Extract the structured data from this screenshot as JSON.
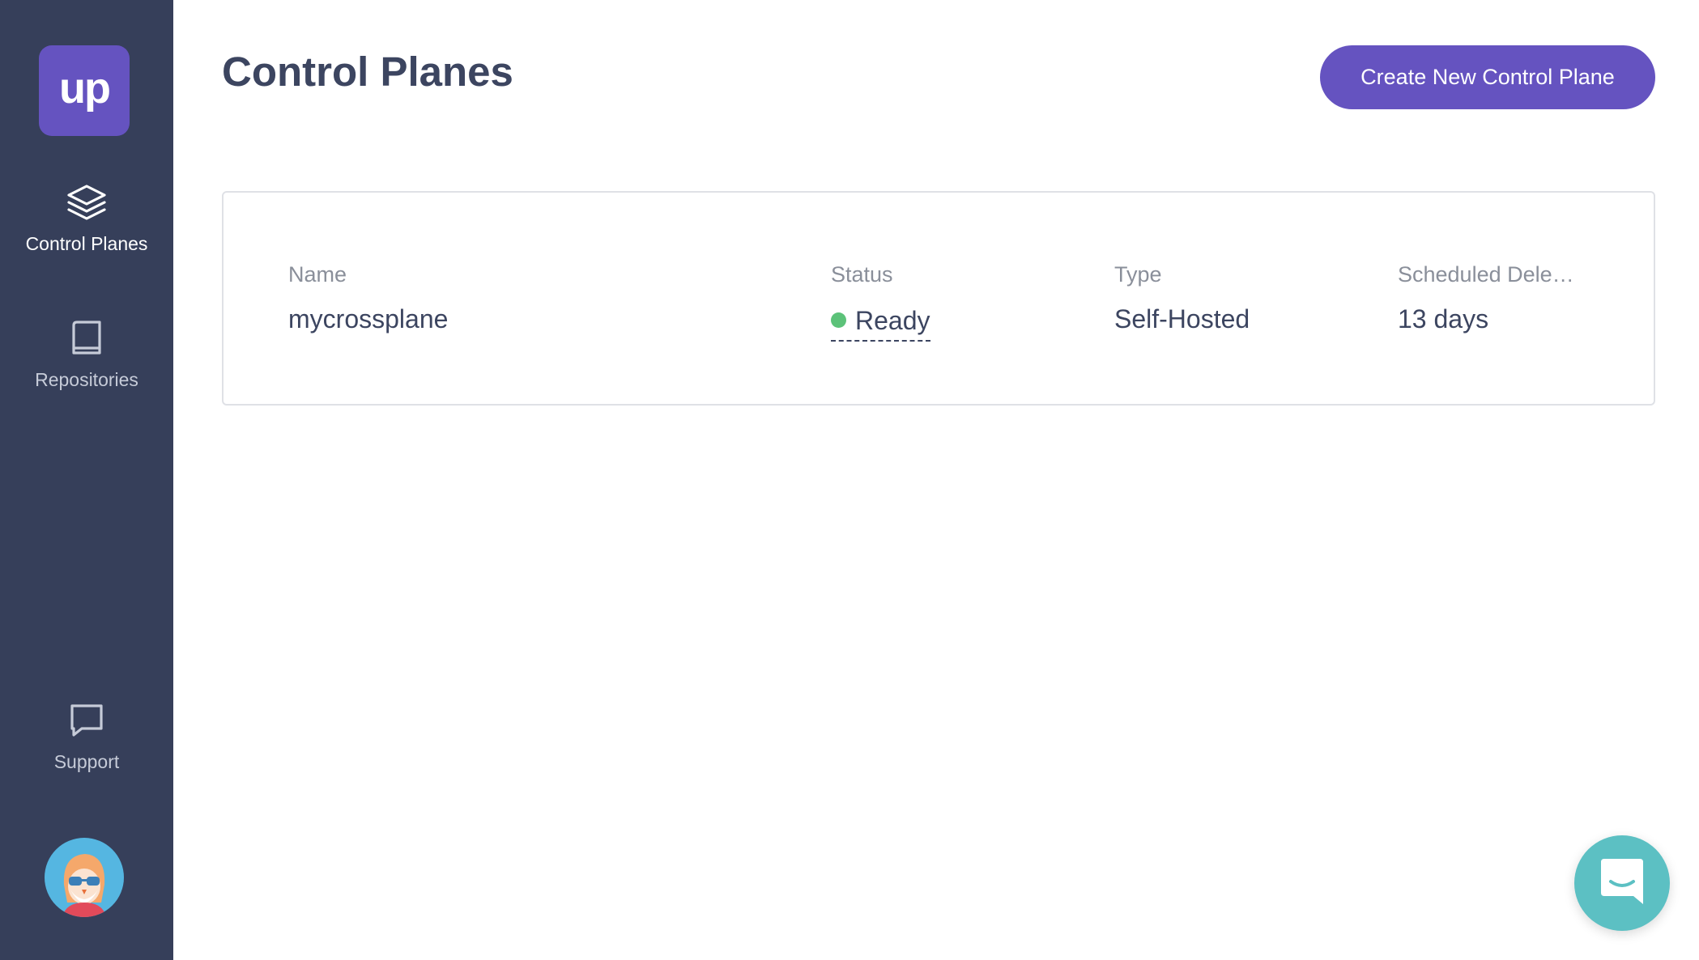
{
  "sidebar": {
    "logo_text": "up",
    "items": [
      {
        "label": "Control Planes",
        "icon": "layers-icon",
        "active": true
      },
      {
        "label": "Repositories",
        "icon": "book-icon",
        "active": false
      }
    ],
    "support": {
      "label": "Support",
      "icon": "chat-bubble-icon"
    },
    "avatar": {
      "icon": "user-avatar-icon"
    }
  },
  "header": {
    "title": "Control Planes",
    "create_button_label": "Create New Control Plane"
  },
  "table": {
    "columns": [
      "Name",
      "Status",
      "Type",
      "Scheduled Dele…"
    ],
    "rows": [
      {
        "name": "mycrossplane",
        "status": "Ready",
        "type": "Self-Hosted",
        "scheduled_deletion": "13 days"
      }
    ]
  },
  "chat_widget": {
    "icon": "intercom-chat-icon"
  },
  "colors": {
    "sidebar_bg": "#363f5a",
    "brand_purple": "#6553c0",
    "status_ready": "#5cc279",
    "chat_widget": "#5cc0c3",
    "avatar_bg": "#55b6e1"
  }
}
